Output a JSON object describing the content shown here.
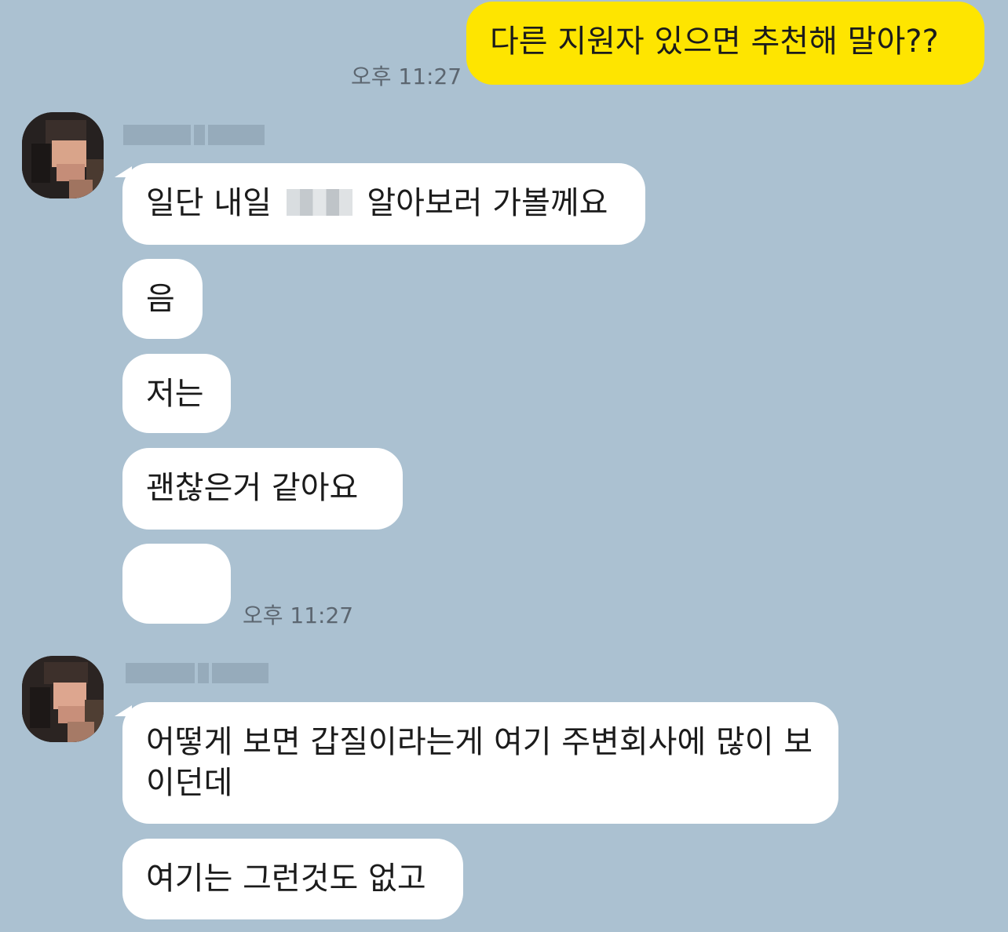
{
  "sent": {
    "text": "다른 지원자 있으면 추천해 말아??",
    "time": "오후 11:27"
  },
  "group1": {
    "messages": [
      {
        "before": "일단 내일",
        "after": "알아보러 가볼께요"
      },
      {
        "text": "음"
      },
      {
        "text": "저는"
      },
      {
        "text": "괜찮은거 같아요"
      },
      {
        "text": ""
      }
    ],
    "time": "오후 11:27"
  },
  "group2": {
    "messages": [
      {
        "text": "어떻게 보면 갑질이라는게 여기 주변회사에 많이 보이던데"
      },
      {
        "text": "여기는 그런것도 없고"
      }
    ]
  }
}
